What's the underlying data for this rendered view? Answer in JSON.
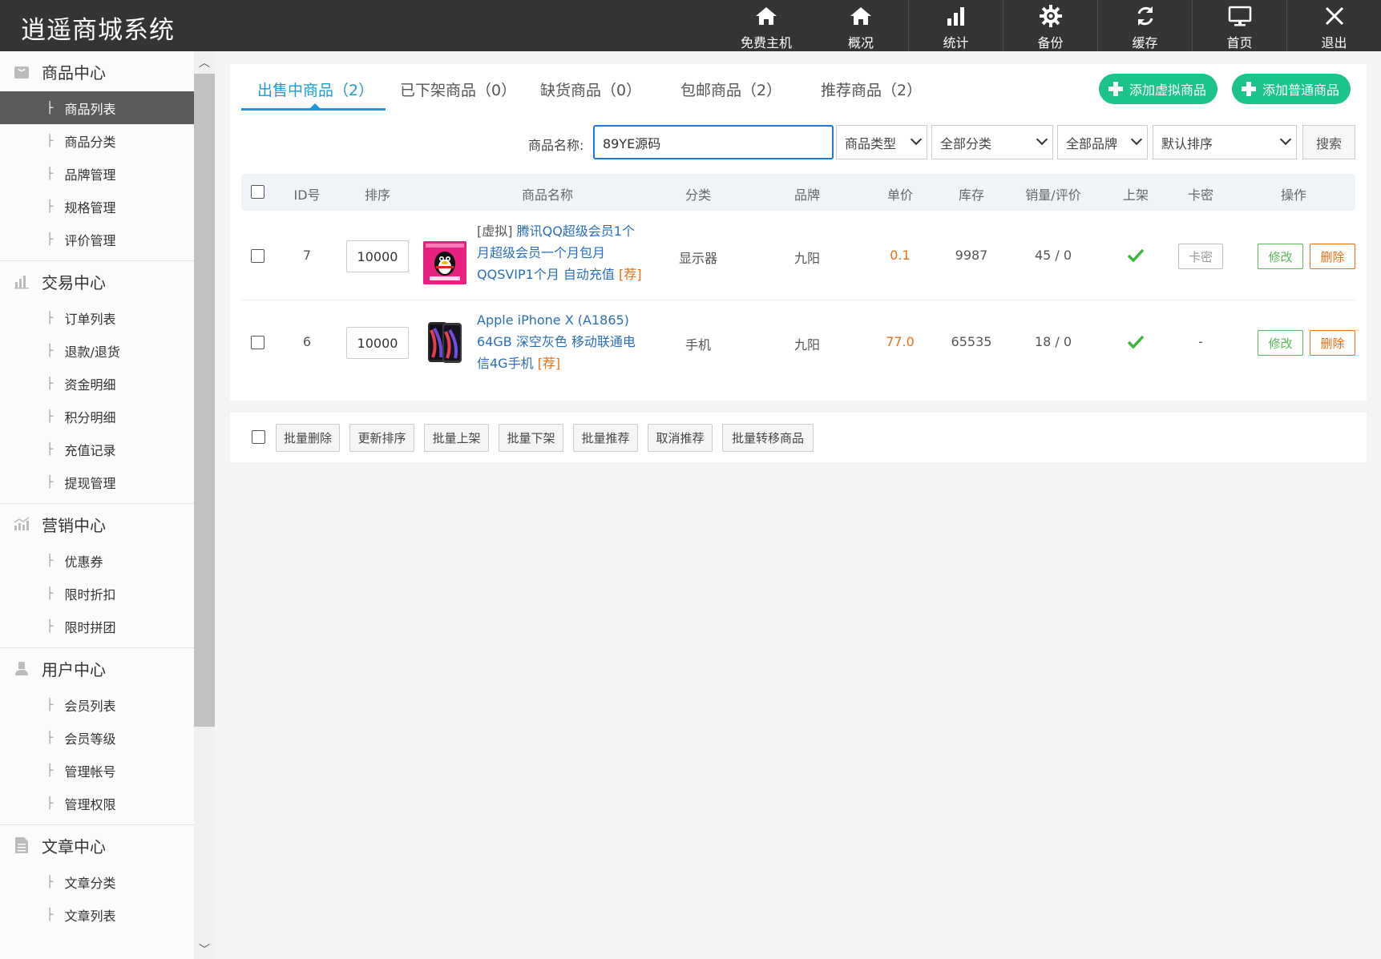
{
  "app": {
    "title": "逍遥商城系统"
  },
  "topnav": [
    {
      "label": "免费主机",
      "icon": "home-icon"
    },
    {
      "label": "概况",
      "icon": "home-icon"
    },
    {
      "label": "统计",
      "icon": "bar-chart-icon"
    },
    {
      "label": "备份",
      "icon": "gear-icon"
    },
    {
      "label": "缓存",
      "icon": "refresh-icon"
    },
    {
      "label": "首页",
      "icon": "monitor-icon"
    },
    {
      "label": "退出",
      "icon": "close-icon"
    }
  ],
  "sidebar": {
    "groups": [
      {
        "title": "商品中心",
        "icon": "bag-icon",
        "items": [
          "商品列表",
          "商品分类",
          "品牌管理",
          "规格管理",
          "评价管理"
        ],
        "active_item": "商品列表"
      },
      {
        "title": "交易中心",
        "icon": "bar-chart-icon",
        "items": [
          "订单列表",
          "退款/退货",
          "资金明细",
          "积分明细",
          "充值记录",
          "提现管理"
        ]
      },
      {
        "title": "营销中心",
        "icon": "trend-chart-icon",
        "items": [
          "优惠券",
          "限时折扣",
          "限时拼团"
        ]
      },
      {
        "title": "用户中心",
        "icon": "user-icon",
        "items": [
          "会员列表",
          "会员等级",
          "管理帐号",
          "管理权限"
        ]
      },
      {
        "title": "文章中心",
        "icon": "document-icon",
        "items": [
          "文章分类",
          "文章列表"
        ]
      }
    ]
  },
  "tabs": [
    {
      "label": "出售中商品（2）",
      "active": true
    },
    {
      "label": "已下架商品（0）"
    },
    {
      "label": "缺货商品（0）"
    },
    {
      "label": "包邮商品（2）"
    },
    {
      "label": "推荐商品（2）"
    }
  ],
  "actions": {
    "add_virtual": "添加虚拟商品",
    "add_normal": "添加普通商品"
  },
  "search": {
    "label": "商品名称:",
    "value": "89YE源码",
    "type_select": "商品类型",
    "category_select": "全部分类",
    "brand_select": "全部品牌",
    "sort_select": "默认排序",
    "button": "搜索"
  },
  "table": {
    "columns": [
      "ID号",
      "排序",
      "商品名称",
      "分类",
      "品牌",
      "单价",
      "库存",
      "销量/评价",
      "上架",
      "卡密",
      "操作"
    ],
    "rows": [
      {
        "id": "7",
        "sort": "10000",
        "name_prefix": "[虚拟]",
        "name": "腾讯QQ超级会员1个月超级会员一个月包月QQSVIP1个月 自动充值",
        "recommend": "[荐]",
        "category": "显示器",
        "brand": "九阳",
        "price": "0.1",
        "stock": "9987",
        "sales": "45 / 0",
        "card": "卡密",
        "edit": "修改",
        "delete": "删除",
        "image_icon": "qq-penguin-icon"
      },
      {
        "id": "6",
        "sort": "10000",
        "name_prefix": "",
        "name": "Apple iPhone X (A1865) 64GB 深空灰色 移动联通电信4G手机",
        "recommend": "[荐]",
        "category": "手机",
        "brand": "九阳",
        "price": "77.0",
        "stock": "65535",
        "sales": "18 / 0",
        "card": "-",
        "edit": "修改",
        "delete": "删除",
        "image_icon": "iphone-icon"
      }
    ]
  },
  "bulk_actions": [
    "批量删除",
    "更新排序",
    "批量上架",
    "批量下架",
    "批量推荐",
    "取消推荐",
    "批量转移商品"
  ],
  "colors": {
    "accent": "#1a9bd6",
    "green": "#1bc58a",
    "orange": "#e86e14",
    "topbar": "#343434"
  }
}
